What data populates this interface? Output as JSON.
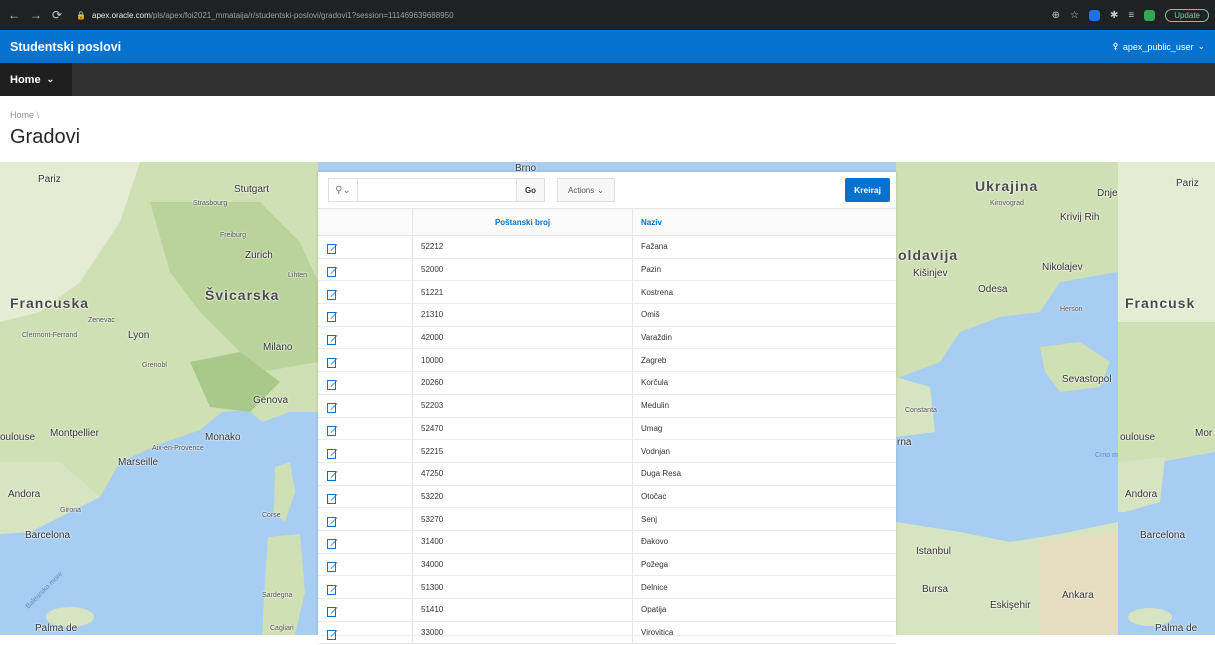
{
  "browser": {
    "url_host": "apex.oracle.com",
    "url_path": "/pls/apex/foi2021_mmataija/r/studentski-poslovi/gradovi1?session=111469639688950",
    "update_label": "Update"
  },
  "header": {
    "app_title": "Studentski poslovi",
    "user_label": "apex_public_user"
  },
  "nav": {
    "home_label": "Home"
  },
  "breadcrumb": {
    "home": "Home"
  },
  "page": {
    "title": "Gradovi"
  },
  "toolbar": {
    "search_value": "",
    "go_label": "Go",
    "actions_label": "Actions",
    "create_label": "Kreiraj"
  },
  "grid": {
    "columns": [
      "Poštanski broj",
      "Naziv"
    ],
    "rows": [
      {
        "postal": "52212",
        "name": "Fažana"
      },
      {
        "postal": "52000",
        "name": "Pazin"
      },
      {
        "postal": "51221",
        "name": "Kostrena"
      },
      {
        "postal": "21310",
        "name": "Omiš"
      },
      {
        "postal": "42000",
        "name": "Varaždin"
      },
      {
        "postal": "10000",
        "name": "Zagreb"
      },
      {
        "postal": "20260",
        "name": "Korčula"
      },
      {
        "postal": "52203",
        "name": "Medulin"
      },
      {
        "postal": "52470",
        "name": "Umag"
      },
      {
        "postal": "52215",
        "name": "Vodnjan"
      },
      {
        "postal": "47250",
        "name": "Duga Resa"
      },
      {
        "postal": "53220",
        "name": "Otočac"
      },
      {
        "postal": "53270",
        "name": "Senj"
      },
      {
        "postal": "31400",
        "name": "Đakovo"
      },
      {
        "postal": "34000",
        "name": "Požega"
      },
      {
        "postal": "51300",
        "name": "Delnice"
      },
      {
        "postal": "51410",
        "name": "Opatija"
      },
      {
        "postal": "33000",
        "name": "Virovitica"
      }
    ]
  },
  "map_labels": {
    "left": [
      "Pariz",
      "Stutgart",
      "Strasbourg",
      "Freiburg",
      "Zurich",
      "Lihten",
      "Švicarska",
      "Francuska",
      "Zenevac",
      "Clermont-Ferrand",
      "Lyon",
      "Milano",
      "Grenobl",
      "Genova",
      "Montpellier",
      "Monako",
      "oulouse",
      "Marseille",
      "Aix-en-Provence",
      "Andora",
      "Girona",
      "Corse",
      "Barcelona",
      "Sardegna",
      "Palma de",
      "Balearsko more",
      "Cagliari",
      "Brno"
    ],
    "right": [
      "Ukrajina",
      "Dnje",
      "Pariz",
      "Kirovograd",
      "Krivij Rih",
      "oldavija",
      "Kišinjev",
      "Nikolajev",
      "Odesa",
      "Herson",
      "Francusk",
      "Sevastopol",
      "Constanta",
      "rna",
      "Istanbul",
      "Bursa",
      "Eskişehir",
      "Ankara",
      "Andora",
      "Barcelona",
      "Mor",
      "oulouse",
      "Palma de",
      "Crno m"
    ]
  },
  "colors": {
    "apex_blue": "#0572ce",
    "nav_dark": "#303030"
  },
  "icons": [
    "search-icon",
    "edit-icon",
    "user-icon",
    "chevron-down-icon"
  ]
}
